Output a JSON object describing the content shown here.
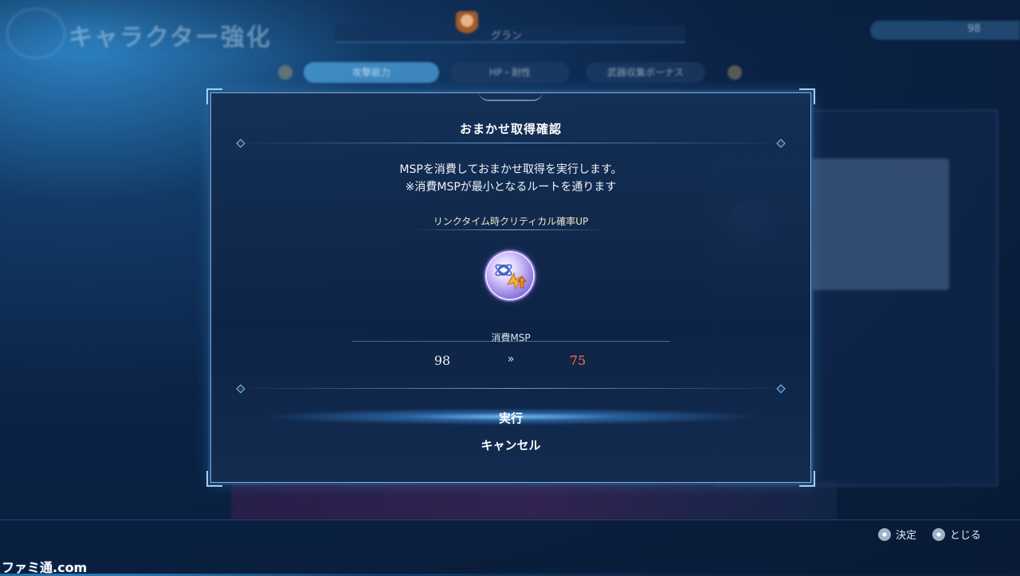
{
  "header": {
    "title": "キャラクター強化",
    "character_name": "グラン",
    "msp_value": "98"
  },
  "tabs": [
    {
      "label": "攻撃能力",
      "active": true
    },
    {
      "label": "HP・耐性",
      "active": false
    },
    {
      "label": "武器収集ボーナス",
      "active": false
    }
  ],
  "dialog": {
    "title": "おまかせ取得確認",
    "message_line1": "MSPを消費しておまかせ取得を実行します。",
    "message_line2": "※消費MSPが最小となるルートを通ります",
    "skill_name": "リンクタイム時クリティカル確率UP",
    "skill_icon": "critical-up-icon",
    "cost_label": "消費MSP",
    "cost_before": "98",
    "cost_arrow": "»",
    "cost_after": "75",
    "execute_label": "実行",
    "cancel_label": "キャンセル",
    "colors": {
      "cost_after": "#ff6a4d",
      "border": "#7fb4dc"
    }
  },
  "footer": {
    "confirm_label": "決定",
    "close_label": "とじる"
  },
  "watermark": "ファミ通.com"
}
